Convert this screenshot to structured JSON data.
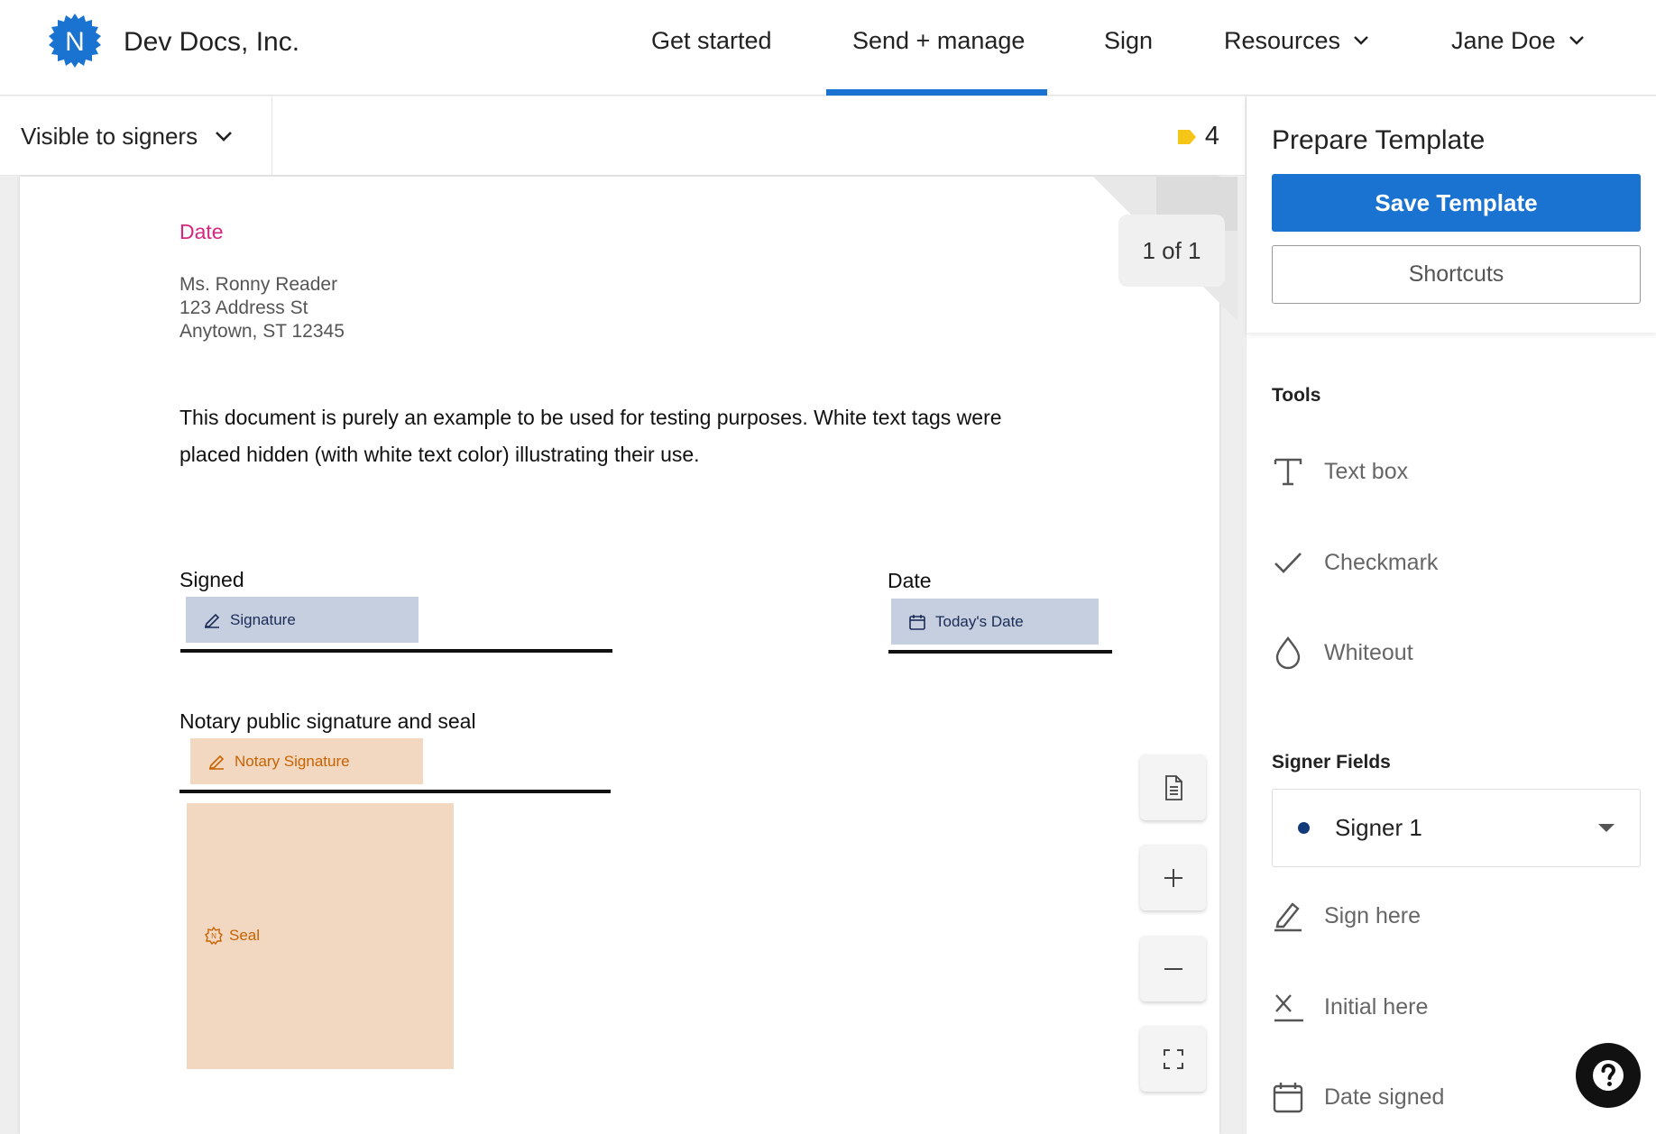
{
  "brand": {
    "logo_letter": "N",
    "company": "Dev Docs, Inc.",
    "accent": "#1a73d1"
  },
  "nav": {
    "items": [
      {
        "label": "Get started"
      },
      {
        "label": "Send + manage",
        "active": true
      },
      {
        "label": "Sign"
      },
      {
        "label": "Resources"
      },
      {
        "label": "Jane Doe"
      }
    ]
  },
  "toolbar": {
    "visibility": "Visible to signers",
    "tag_count": "4"
  },
  "document": {
    "page_counter": "1 of 1",
    "date_tag": "Date",
    "address": [
      "Ms. Ronny Reader",
      "123 Address St",
      "Anytown, ST 12345"
    ],
    "body_lines": [
      "This document is purely an example to be used for testing purposes. White text tags were",
      "placed hidden (with white text color) illustrating their use."
    ],
    "signed_label": "Signed",
    "date_label": "Date",
    "notary_label": "Notary public signature and seal",
    "fields": {
      "signature": "Signature",
      "todays_date": "Today's Date",
      "notary_signature": "Notary Signature",
      "seal": "Seal"
    }
  },
  "panel": {
    "title": "Prepare Template",
    "save_label": "Save Template",
    "shortcuts_label": "Shortcuts",
    "tools_title": "Tools",
    "tools": [
      "Text box",
      "Checkmark",
      "Whiteout"
    ],
    "signer_fields_title": "Signer Fields",
    "signer_selected": "Signer 1",
    "signer_fields": [
      "Sign here",
      "Initial here",
      "Date signed"
    ]
  }
}
